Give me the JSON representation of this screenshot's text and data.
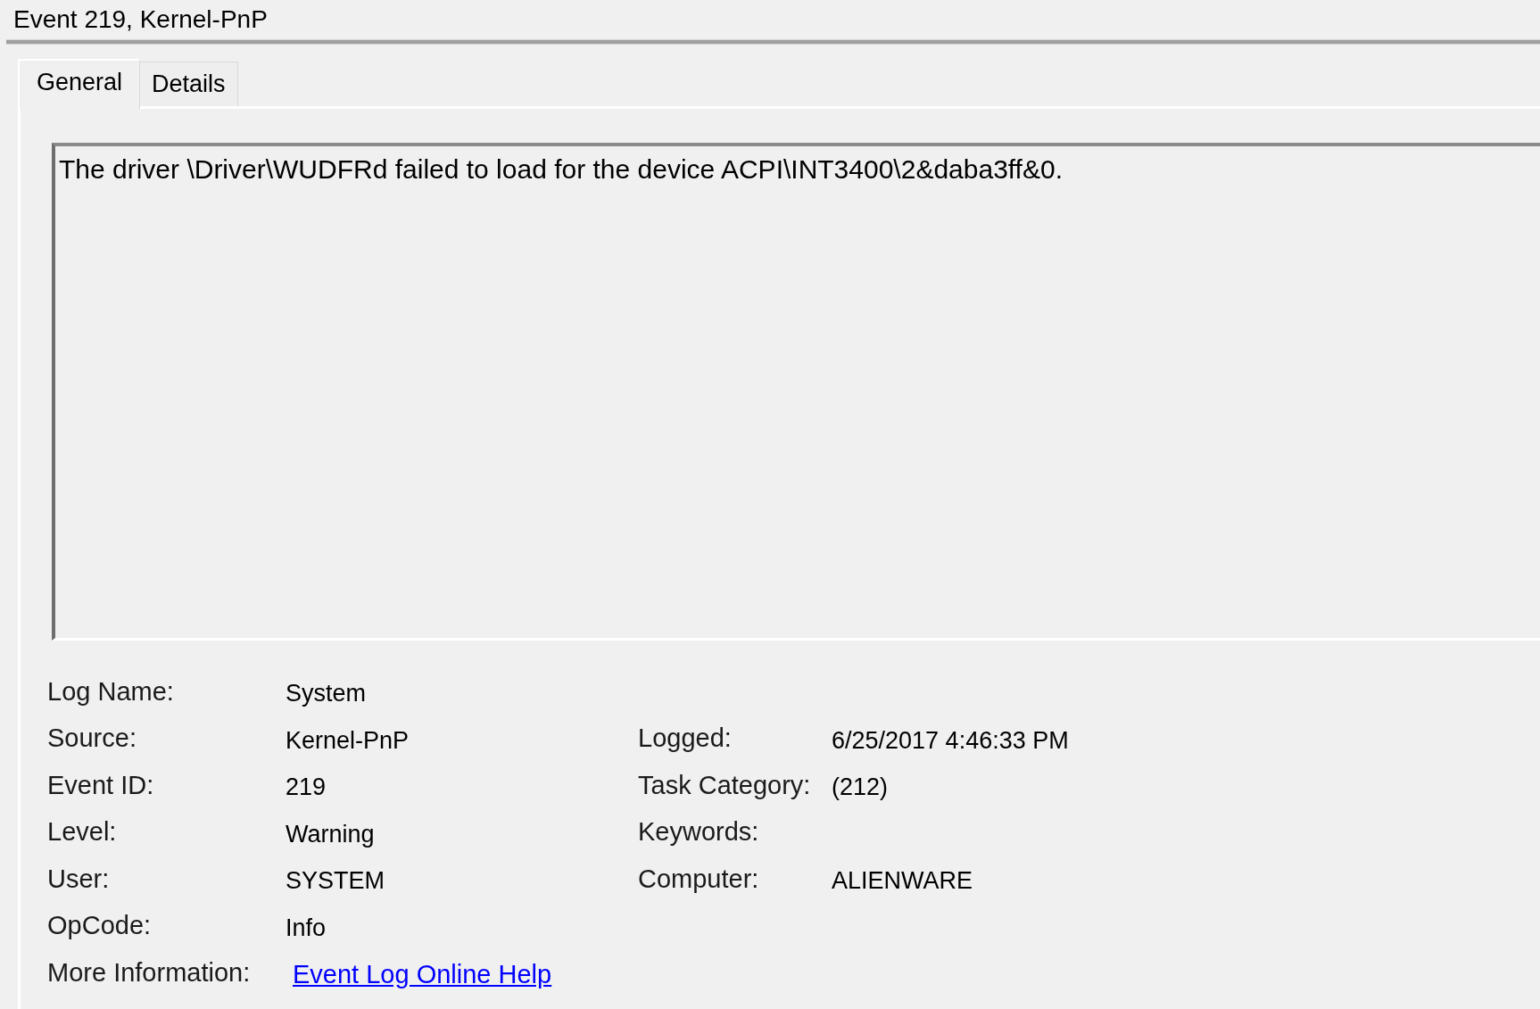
{
  "window": {
    "title": "Event 219, Kernel-PnP"
  },
  "tabs": [
    {
      "label": "General",
      "selected": true
    },
    {
      "label": "Details",
      "selected": false
    }
  ],
  "general": {
    "description": "The driver \\Driver\\WUDFRd failed to load for the device ACPI\\INT3400\\2&daba3ff&0.",
    "rows": [
      {
        "left": {
          "label": "Log Name:",
          "kind": "text",
          "value": "System"
        }
      },
      {
        "left": {
          "label": "Source:",
          "kind": "text",
          "value": "Kernel-PnP"
        },
        "right": {
          "label": "Logged:",
          "kind": "text",
          "value": "6/25/2017 4:46:33 PM"
        }
      },
      {
        "left": {
          "label": "Event ID:",
          "kind": "text",
          "value": "219"
        },
        "right": {
          "label": "Task Category:",
          "kind": "text",
          "value": "(212)"
        }
      },
      {
        "left": {
          "label": "Level:",
          "kind": "text",
          "value": "Warning"
        },
        "right": {
          "label": "Keywords:"
        }
      },
      {
        "left": {
          "label": "User:",
          "kind": "text",
          "value": "SYSTEM"
        },
        "right": {
          "label": "Computer:",
          "kind": "text",
          "value": "ALIENWARE"
        }
      },
      {
        "left": {
          "label": "OpCode:",
          "kind": "text",
          "value": "Info"
        }
      },
      {
        "left": {
          "label": "More Information:",
          "kind": "link",
          "value": "Event Log Online Help"
        }
      }
    ]
  }
}
